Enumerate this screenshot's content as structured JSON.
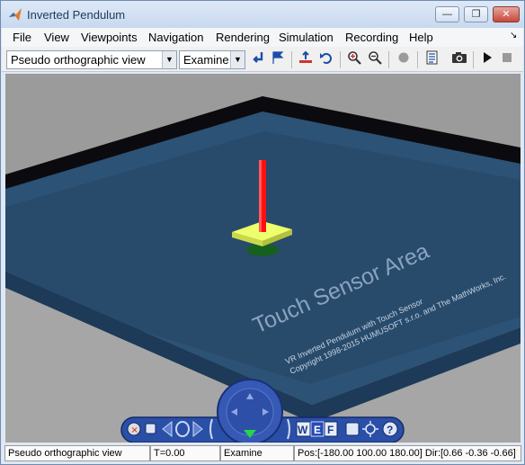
{
  "window": {
    "title": "Inverted Pendulum"
  },
  "window_controls": {
    "minimize": "—",
    "restore": "❐",
    "close": "✕"
  },
  "menu": [
    {
      "label": "File"
    },
    {
      "label": "View"
    },
    {
      "label": "Viewpoints"
    },
    {
      "label": "Navigation"
    },
    {
      "label": "Rendering"
    },
    {
      "label": "Simulation"
    },
    {
      "label": "Recording"
    },
    {
      "label": "Help"
    }
  ],
  "toolbar": {
    "viewpoint_select": "Pseudo orthographic view",
    "navigation_select": "Examine"
  },
  "scene": {
    "sensor_label": "Touch Sensor Area",
    "footer_line1": "VR Inverted Pendulum with Touch Sensor",
    "footer_line2": "Copyright 1998-2015 HUMUSOFT s.r.o. and The MathWorks, Inc."
  },
  "nav_panel": {
    "walk": "W",
    "examine": "E",
    "fly": "F",
    "help": "?"
  },
  "status": {
    "viewpoint": "Pseudo orthographic view",
    "time": "T=0.00",
    "mode": "Examine",
    "position": "Pos:[-180.00 100.00 180.00] Dir:[0.66 -0.36 -0.66]"
  },
  "colors": {
    "background": "#9b9b9b",
    "plate_top": "#2b5174",
    "plate_inner": "#284b6b",
    "pendulum_rod": "#ff0000",
    "pendulum_base": "#eeff6c",
    "nav_panel": "#2e4fa8"
  }
}
